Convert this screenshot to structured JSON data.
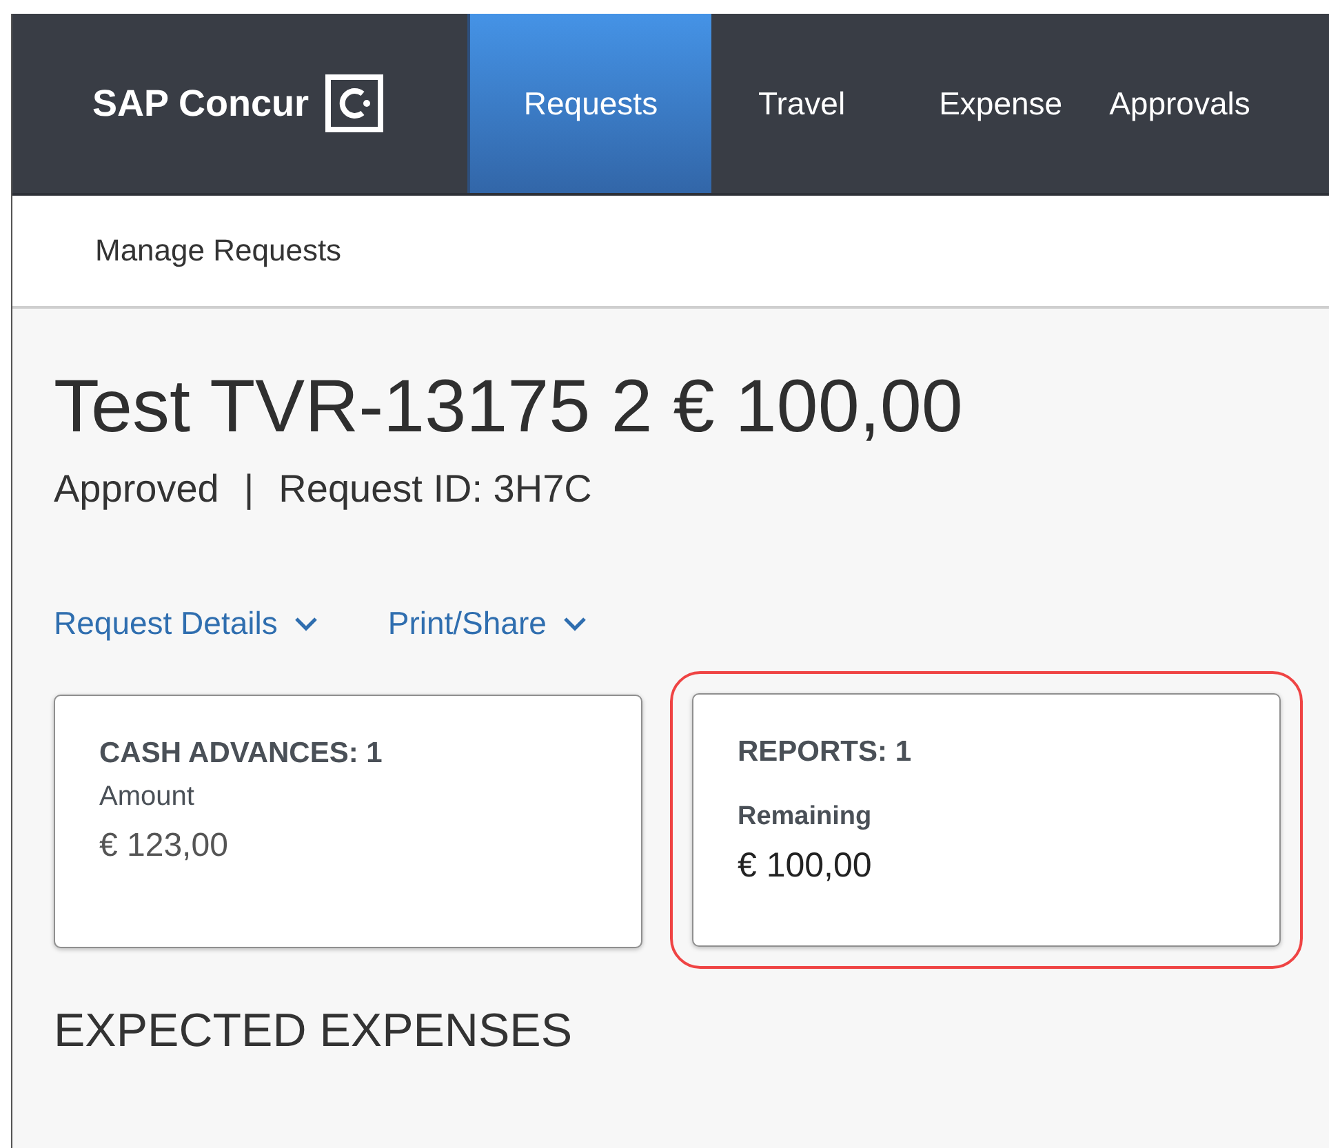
{
  "header": {
    "brand": "SAP Concur",
    "tabs": [
      {
        "label": "Requests",
        "selected": true
      },
      {
        "label": "Travel",
        "selected": false
      },
      {
        "label": "Expense",
        "selected": false
      },
      {
        "label": "Approvals",
        "selected": false
      }
    ]
  },
  "subnav": {
    "label": "Manage Requests"
  },
  "request": {
    "title": "Test TVR-13175 2 € 100,00",
    "status": "Approved",
    "separator": "|",
    "id_text": "Request ID: 3H7C"
  },
  "actions": [
    {
      "label": "Request Details"
    },
    {
      "label": "Print/Share"
    }
  ],
  "cards": [
    {
      "kind": "amount",
      "title": "CASH ADVANCES: 1",
      "label": "Amount",
      "value": "€ 123,00",
      "highlighted": false
    },
    {
      "kind": "remaining",
      "title": "REPORTS: 1",
      "label": "Remaining",
      "value": "€ 100,00",
      "highlighted": true
    }
  ],
  "section_title": "EXPECTED EXPENSES"
}
